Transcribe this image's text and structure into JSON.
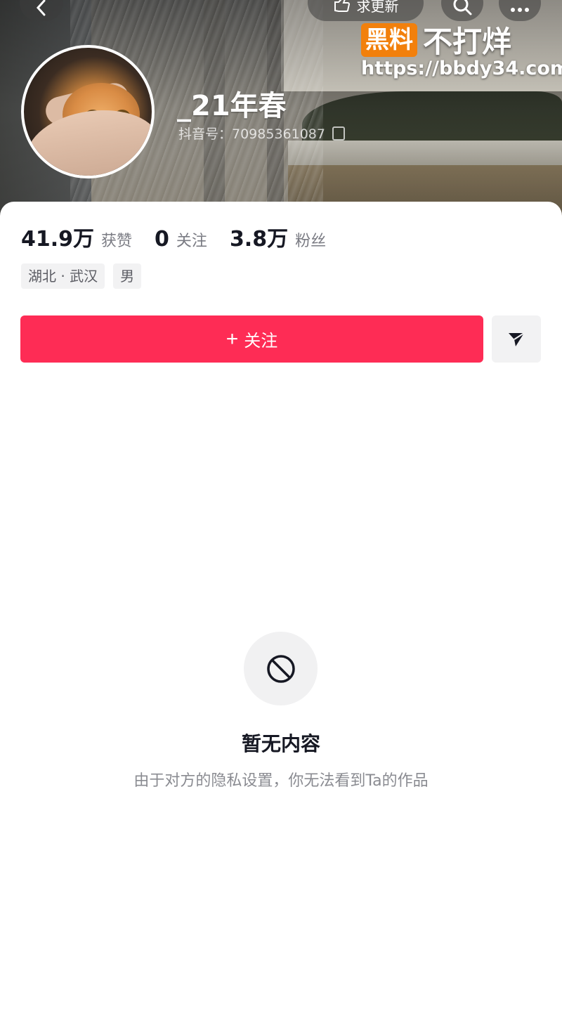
{
  "header": {
    "update_label": "求更新",
    "watermark_badge": "黑料",
    "watermark_text": "不打烊",
    "watermark_url": "https://bbdy34.com"
  },
  "profile": {
    "nickname": "_21年春",
    "douyin_id": "抖音号：70985361087"
  },
  "stats": [
    {
      "value": "41.9万",
      "label": "获赞"
    },
    {
      "value": "0",
      "label": "关注"
    },
    {
      "value": "3.8万",
      "label": "粉丝"
    }
  ],
  "tags": [
    "湖北 · 武汉",
    "男"
  ],
  "actions": {
    "follow_plus": "+",
    "follow_label": "关注"
  },
  "empty_state": {
    "title": "暂无内容",
    "description": "由于对方的隐私设置，你无法看到Ta的作品"
  },
  "colors": {
    "accent": "#fe2c55",
    "watermark": "#f2800c"
  }
}
